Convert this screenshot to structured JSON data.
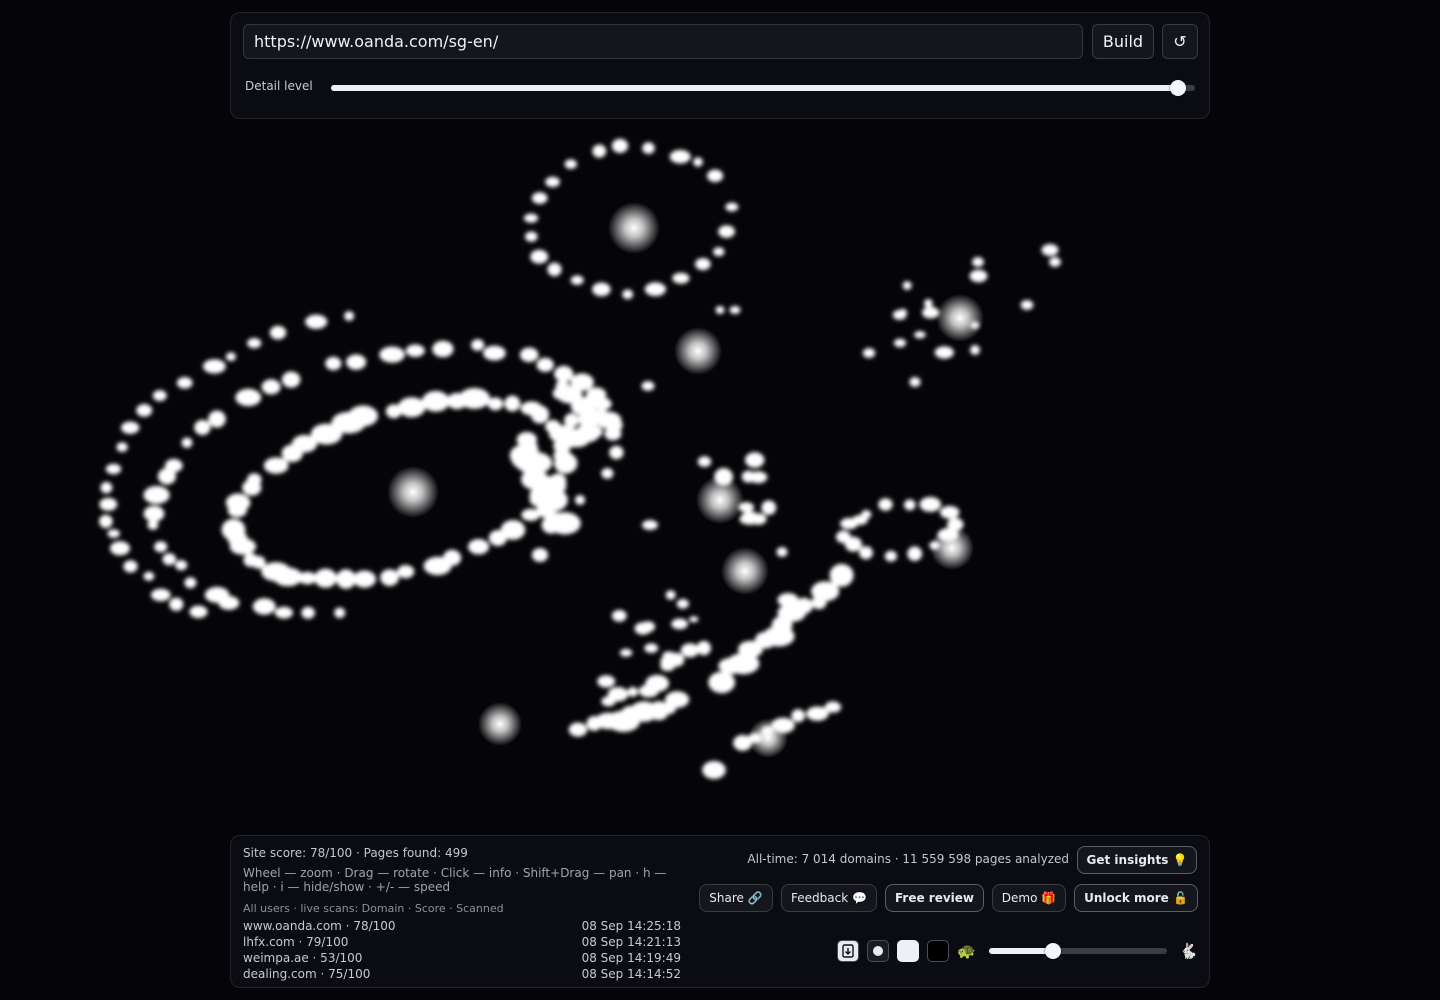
{
  "top": {
    "url_value": "https://www.oanda.com/sg-en/",
    "build_label": "Build",
    "reset_label": "↺",
    "detail_label": "Detail level",
    "detail_level_fraction": 0.98
  },
  "bottom": {
    "stats": "Site score: 78/100 · Pages found: 499",
    "help": "Wheel — zoom · Drag — rotate · Click — info · Shift+Drag — pan · h — help · i — hide/show · +/- — speed",
    "scans_header": "All users · live scans: Domain · Score · Scanned",
    "scans": [
      {
        "domain": "www.oanda.com · 78/100",
        "time": "08 Sep 14:25:18"
      },
      {
        "domain": "lhfx.com · 79/100",
        "time": "08 Sep 14:21:13"
      },
      {
        "domain": "weimpa.ae · 53/100",
        "time": "08 Sep 14:19:49"
      },
      {
        "domain": "dealing.com · 75/100",
        "time": "08 Sep 14:14:52"
      }
    ],
    "alltime": "All-time: 7 014 domains · 11 559 598 pages analyzed",
    "buttons": {
      "insights": "Get insights 💡",
      "share": "Share 🔗",
      "feedback": "Feedback 💬",
      "review": "Free review",
      "demo": "Demo 🎁",
      "unlock": "Unlock more 🔓"
    },
    "speed_fraction": 0.36,
    "slow_icon": "🐢",
    "fast_icon": "🐇"
  },
  "icons": [
    "download-icon",
    "dot-theme-icon",
    "light-theme-icon",
    "dark-theme-icon",
    "turtle-icon",
    "rabbit-icon",
    "reset-icon"
  ]
}
